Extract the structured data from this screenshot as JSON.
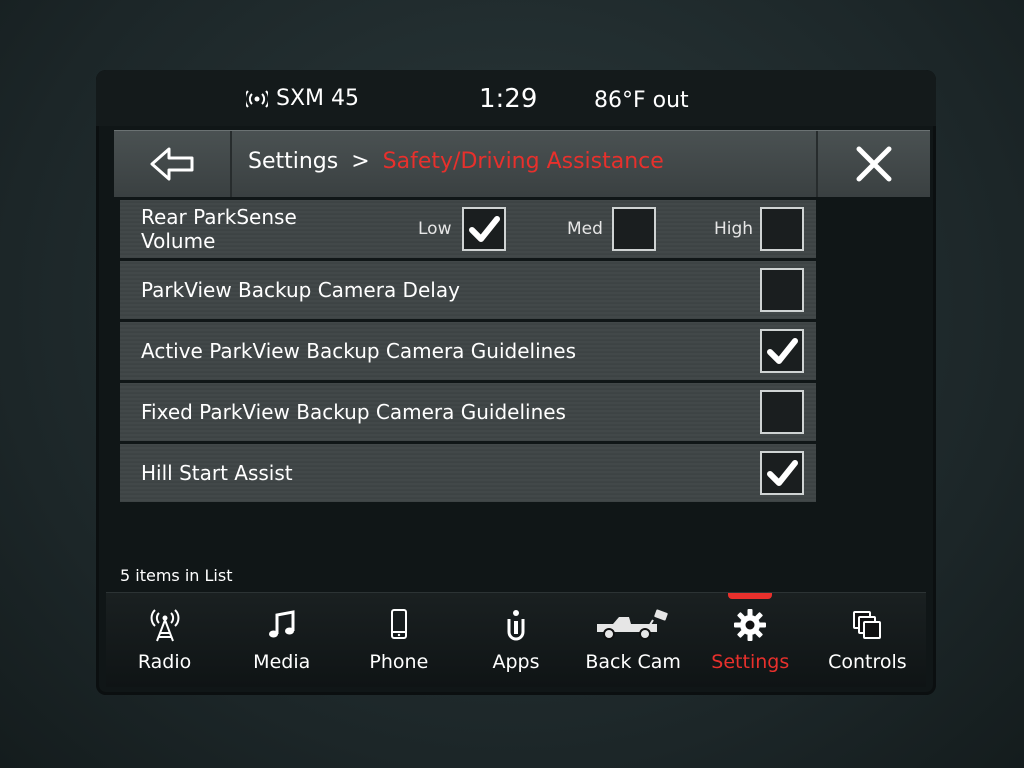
{
  "status": {
    "radio_station": "SXM 45",
    "time": "1:29",
    "outside_temp": "86°F out"
  },
  "header": {
    "back_icon": "back-arrow-icon",
    "breadcrumb_root": "Settings",
    "breadcrumb_sep": ">",
    "breadcrumb_current": "Safety/Driving Assistance",
    "close_icon": "close-icon",
    "accent_color": "#e8302c"
  },
  "settings": {
    "parksense": {
      "label": "Rear ParkSense Volume",
      "options": [
        {
          "label": "Low",
          "checked": true
        },
        {
          "label": "Med",
          "checked": false
        },
        {
          "label": "High",
          "checked": false
        }
      ]
    },
    "items": [
      {
        "label": "ParkView Backup Camera Delay",
        "checked": false
      },
      {
        "label": "Active ParkView Backup Camera Guidelines",
        "checked": true
      },
      {
        "label": "Fixed ParkView Backup Camera Guidelines",
        "checked": false
      },
      {
        "label": "Hill Start Assist",
        "checked": true
      }
    ],
    "count_text": "5 items in List"
  },
  "nav": {
    "items": [
      {
        "label": "Radio",
        "icon": "radio-tower-icon",
        "active": false
      },
      {
        "label": "Media",
        "icon": "music-note-icon",
        "active": false
      },
      {
        "label": "Phone",
        "icon": "phone-icon",
        "active": false
      },
      {
        "label": "Apps",
        "icon": "apps-icon",
        "active": false
      },
      {
        "label": "Back Cam",
        "icon": "truck-camera-icon",
        "active": false
      },
      {
        "label": "Settings",
        "icon": "gear-icon",
        "active": true
      },
      {
        "label": "Controls",
        "icon": "controls-icon",
        "active": false
      }
    ]
  }
}
